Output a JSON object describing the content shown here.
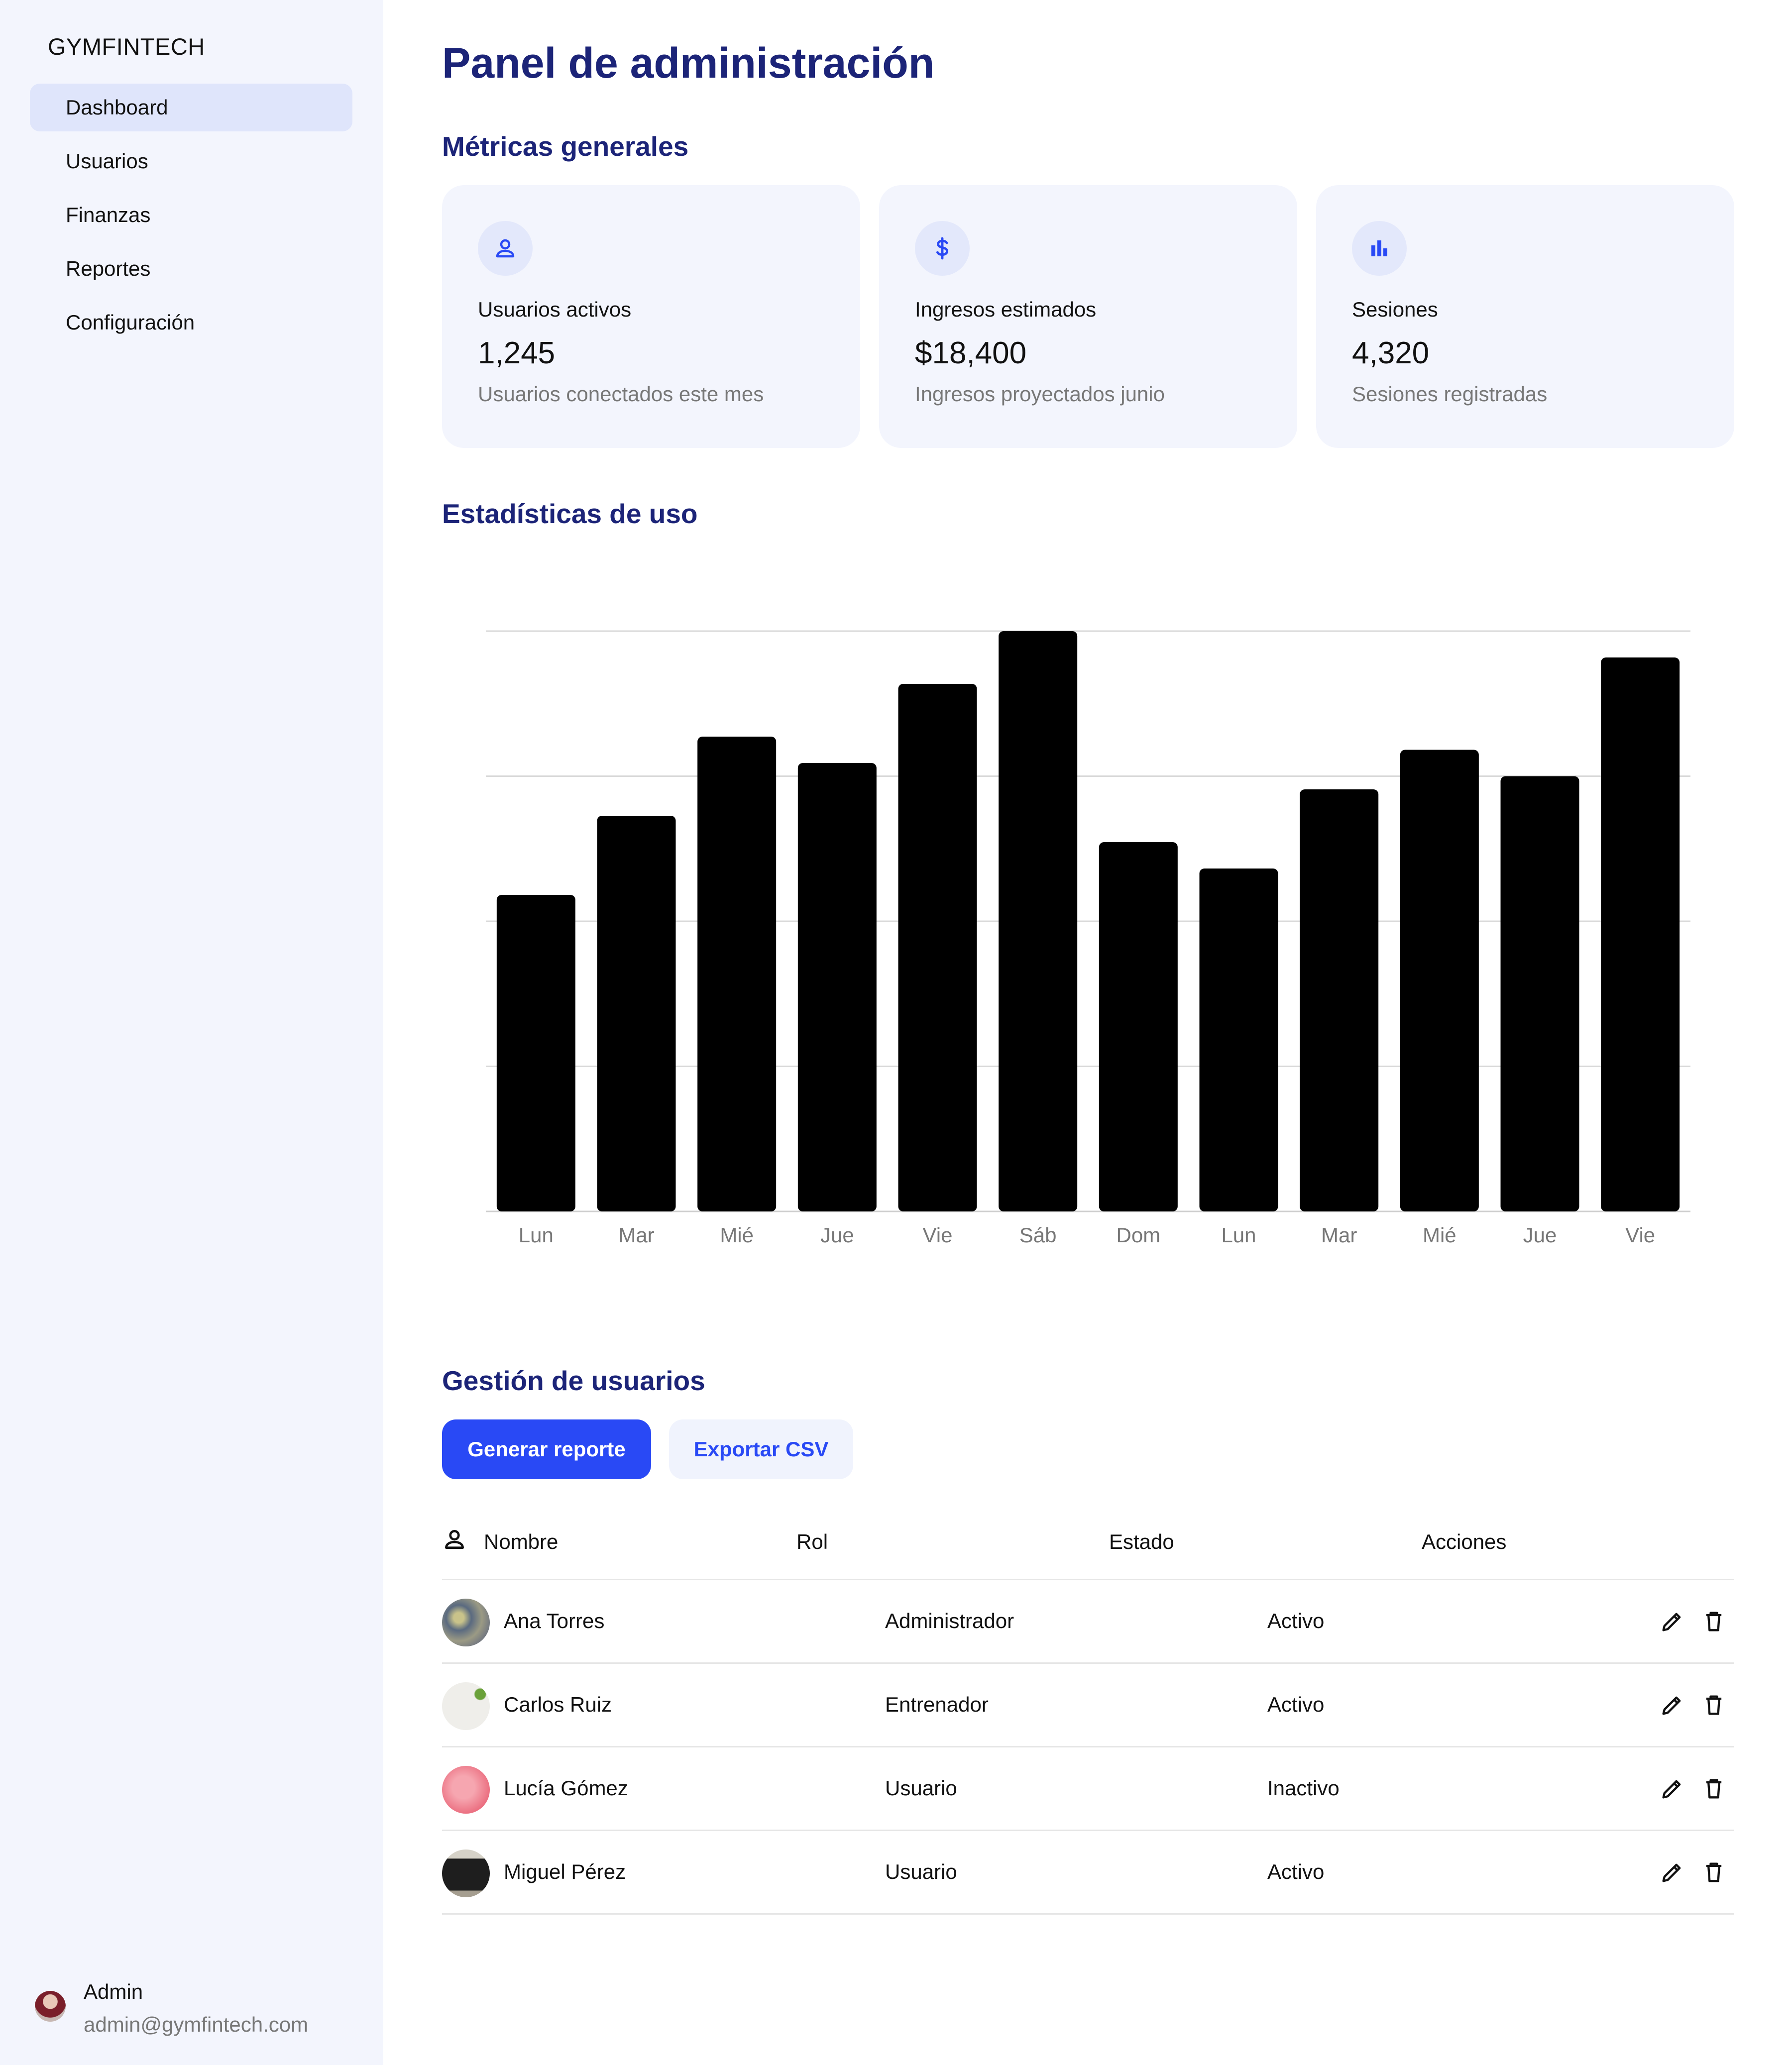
{
  "sidebar": {
    "brand": "GYMFINTECH",
    "items": [
      {
        "label": "Dashboard",
        "active": true
      },
      {
        "label": "Usuarios",
        "active": false
      },
      {
        "label": "Finanzas",
        "active": false
      },
      {
        "label": "Reportes",
        "active": false
      },
      {
        "label": "Configuración",
        "active": false
      }
    ],
    "user": {
      "name": "Admin",
      "email": "admin@gymfintech.com"
    }
  },
  "header": {
    "title": "Panel de administración"
  },
  "metrics": {
    "title": "Métricas generales",
    "cards": [
      {
        "icon": "person-icon",
        "label": "Usuarios activos",
        "value": "1,245",
        "subtitle": "Usuarios conectados este mes"
      },
      {
        "icon": "dollar-icon",
        "label": "Ingresos estimados",
        "value": "$18,400",
        "subtitle": "Ingresos proyectados junio"
      },
      {
        "icon": "bar-chart-icon",
        "label": "Sesiones",
        "value": "4,320",
        "subtitle": "Sesiones registradas"
      }
    ]
  },
  "usage": {
    "title": "Estadísticas de uso"
  },
  "chart_data": {
    "type": "bar",
    "title": "",
    "xlabel": "",
    "ylabel": "",
    "categories": [
      "Lun",
      "Mar",
      "Mié",
      "Jue",
      "Vie",
      "Sáb",
      "Dom",
      "Lun",
      "Mar",
      "Mié",
      "Jue",
      "Vie"
    ],
    "values": [
      120,
      150,
      180,
      170,
      200,
      220,
      140,
      130,
      160,
      175,
      165,
      210
    ],
    "ylim": [
      0,
      220
    ],
    "grid": true,
    "bar_color": "#000000"
  },
  "users": {
    "title": "Gestión de usuarios",
    "generate_report": "Generar reporte",
    "export_csv": "Exportar CSV",
    "columns": [
      "Nombre",
      "Rol",
      "Estado",
      "Acciones"
    ],
    "rows": [
      {
        "name": "Ana Torres",
        "role": "Administrador",
        "status": "Activo"
      },
      {
        "name": "Carlos Ruiz",
        "role": "Entrenador",
        "status": "Activo"
      },
      {
        "name": "Lucía Gómez",
        "role": "Usuario",
        "status": "Inactivo"
      },
      {
        "name": "Miguel Pérez",
        "role": "Usuario",
        "status": "Activo"
      }
    ]
  },
  "colors": {
    "accent": "#2949f5",
    "heading": "#1c2478",
    "sidebar_bg": "#f3f5fd"
  }
}
